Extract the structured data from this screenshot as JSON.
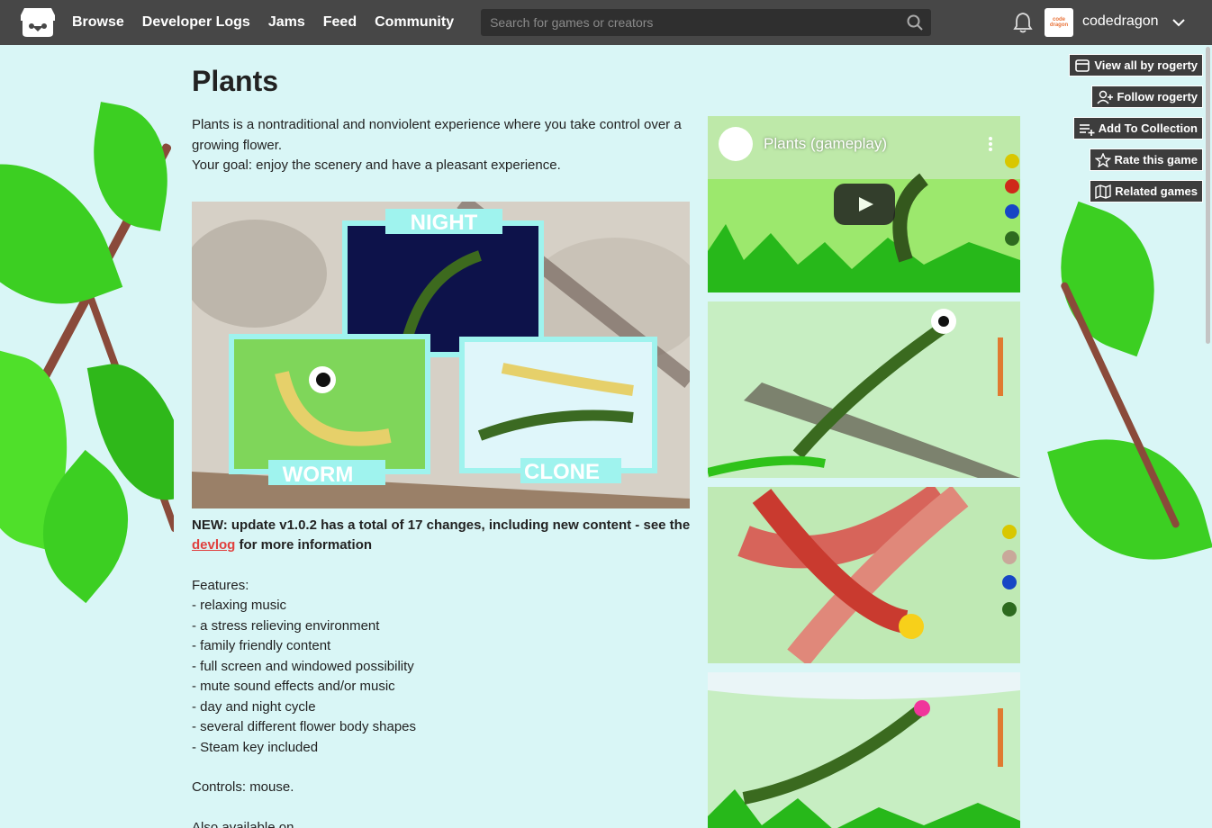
{
  "nav": {
    "links": [
      "Browse",
      "Developer Logs",
      "Jams",
      "Feed",
      "Community"
    ],
    "search_placeholder": "Search for games or creators",
    "username": "codedragon",
    "avatar_text": "code dragon"
  },
  "game": {
    "title": "Plants",
    "intro_1": "Plants is a nontraditional and nonviolent experience where you take control over a growing flower.",
    "intro_2": "Your goal: enjoy the scenery and have a pleasant experience.",
    "hero_labels": {
      "night": "NIGHT",
      "worm": "WORM",
      "clone": "CLONE"
    },
    "update_pre": "NEW: update v1.0.2 has a total of 17 changes, including new content - see the",
    "update_link": "devlog",
    "update_post": "for more information",
    "features_heading": "Features:",
    "features": [
      "- relaxing music",
      "- a stress relieving environment",
      "- family friendly content",
      "- full screen and windowed possibility",
      "- mute sound effects and/or music",
      "- day and night cycle",
      "- several different flower body shapes",
      "- Steam key included"
    ],
    "controls": "Controls: mouse.",
    "also_available": "Also available on"
  },
  "video": {
    "title": "Plants (gameplay)"
  },
  "side_buttons": [
    {
      "label": "View all by rogerty",
      "icon": "store-icon"
    },
    {
      "label": "Follow rogerty",
      "icon": "add-user-icon"
    },
    {
      "label": "Add To Collection",
      "icon": "add-list-icon"
    },
    {
      "label": "Rate this game",
      "icon": "star-icon"
    },
    {
      "label": "Related games",
      "icon": "map-icon"
    }
  ],
  "colors": {
    "topbar": "#474747",
    "page_bg": "#d9f6f6",
    "link": "#e0403e",
    "leaf": "#3ccf22"
  }
}
